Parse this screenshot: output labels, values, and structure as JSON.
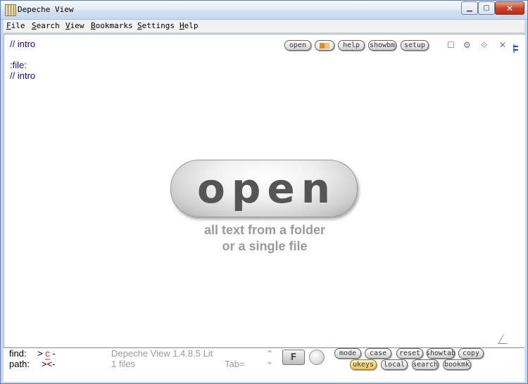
{
  "window": {
    "title": "Depeche View"
  },
  "menu": [
    "File",
    "Search",
    "View",
    "Bookmarks",
    "Settings",
    "Help"
  ],
  "toolbar": {
    "open": "open",
    "help": "help",
    "showbm": "showbm",
    "setup": "setup"
  },
  "editor": {
    "line1": "// intro",
    "line2": ":file:",
    "line3": "// intro"
  },
  "hero": {
    "button": "open",
    "tagline1": "all text from a folder",
    "tagline2": "or a single file"
  },
  "status": {
    "find_label": "find:",
    "find_value": ">",
    "find_highlight": "c",
    "find_tail": "-",
    "path_label": "path:",
    "path_value": "><-",
    "app_version": "Depeche View 1.4.8.5 Lit",
    "files_count": "1 files",
    "tab_label": "Tab=",
    "f_label": "F"
  },
  "buttons": {
    "mode": "mode",
    "case": "case",
    "reset": "reset",
    "showtab": "showtab",
    "copy": "copy",
    "ukeys": "ukeys",
    "local": "local",
    "search": "search",
    "bookmk": "bookmk"
  },
  "colors": {
    "code_text": "#10107a",
    "hint_gray": "#9a9a9a",
    "gold_button": "#f2c24f"
  }
}
